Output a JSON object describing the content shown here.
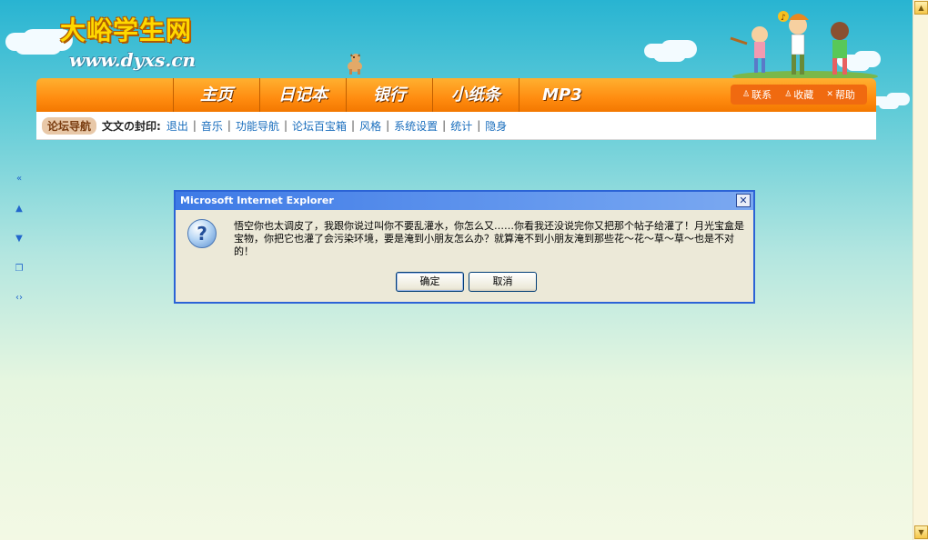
{
  "site": {
    "title": "大峪学生网",
    "url_text": "www.dyxs.cn"
  },
  "nav": {
    "items": [
      "主页",
      "日记本",
      "银行",
      "小纸条",
      "MP3"
    ],
    "links": [
      {
        "label": "联系",
        "icon": "person-icon"
      },
      {
        "label": "收藏",
        "icon": "person-icon"
      },
      {
        "label": "帮助",
        "icon": "close-icon"
      }
    ]
  },
  "subbar": {
    "forum_nav": "论坛导航",
    "user_label": "文文の封印:",
    "links": [
      "退出",
      "音乐",
      "功能导航",
      "论坛百宝箱",
      "风格",
      "系统设置",
      "统计",
      "隐身"
    ]
  },
  "side_icons": [
    "double-left-arrow-icon",
    "up-arrow-icon",
    "down-arrow-icon",
    "window-icon",
    "code-icon"
  ],
  "dialog": {
    "title": "Microsoft Internet Explorer",
    "close": "✕",
    "icon": "question-icon",
    "message": "悟空你也太调皮了，我跟你说过叫你不要乱灌水，你怎么又……你看我还没说完你又把那个帖子给灌了！月光宝盒是宝物，你把它也灌了会污染环境，要是淹到小朋友怎么办？就算淹不到小朋友淹到那些花～花～草～草～也是不对的！",
    "ok_label": "确定",
    "cancel_label": "取消"
  },
  "colors": {
    "navbar": "#ff8c10",
    "dialog_title": "#3e7ae6",
    "link": "#1a6ebd"
  }
}
